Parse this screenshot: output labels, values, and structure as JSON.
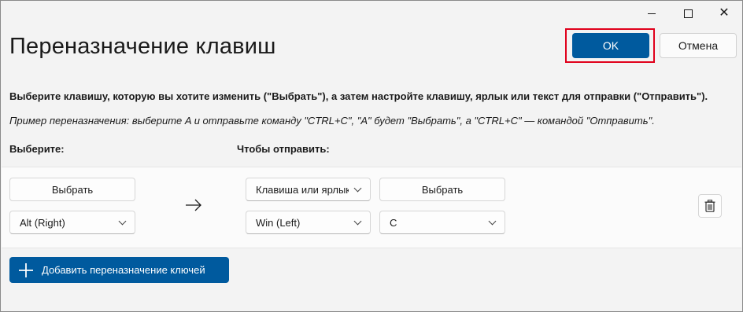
{
  "window": {
    "controls": {
      "minimize": "—",
      "maximize": "□",
      "close": "✕"
    }
  },
  "header": {
    "title": "Переназначение клавиш",
    "ok_label": "OK",
    "cancel_label": "Отмена"
  },
  "instructions": {
    "main": "Выберите клавишу, которую вы хотите изменить (\"Выбрать\"), а затем настройте клавишу, ярлык или текст для отправки (\"Отправить\").",
    "example": "Пример переназначения: выберите A и отправьте команду \"CTRL+C\", \"A\" будет \"Выбрать\", а \"CTRL+C\" — командой \"Отправить\"."
  },
  "columns": {
    "select_label": "Выберите:",
    "send_label": "Чтобы отправить:"
  },
  "mapping": {
    "select_button": "Выбрать",
    "original_key": "Alt (Right)",
    "send_type": "Клавиша или ярлык",
    "send_select_button": "Выбрать",
    "target_modifier": "Win (Left)",
    "target_key": "C"
  },
  "footer": {
    "add_label": "Добавить переназначение ключей"
  },
  "colors": {
    "accent": "#005a9e",
    "highlight": "#e0001b",
    "background": "#f3f3f3"
  }
}
